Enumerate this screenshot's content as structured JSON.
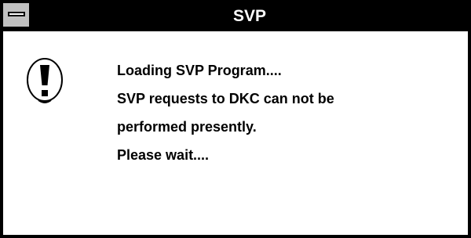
{
  "window": {
    "title": "SVP"
  },
  "dialog": {
    "icon": "exclamation-icon",
    "messages": [
      "Loading SVP Program....",
      "SVP requests to DKC can not be",
      "performed presently.",
      "Please wait...."
    ]
  },
  "colors": {
    "titlebar": "#000000",
    "title_text": "#ffffff",
    "background": "#ffffff",
    "system_menu": "#c0c0c0"
  }
}
